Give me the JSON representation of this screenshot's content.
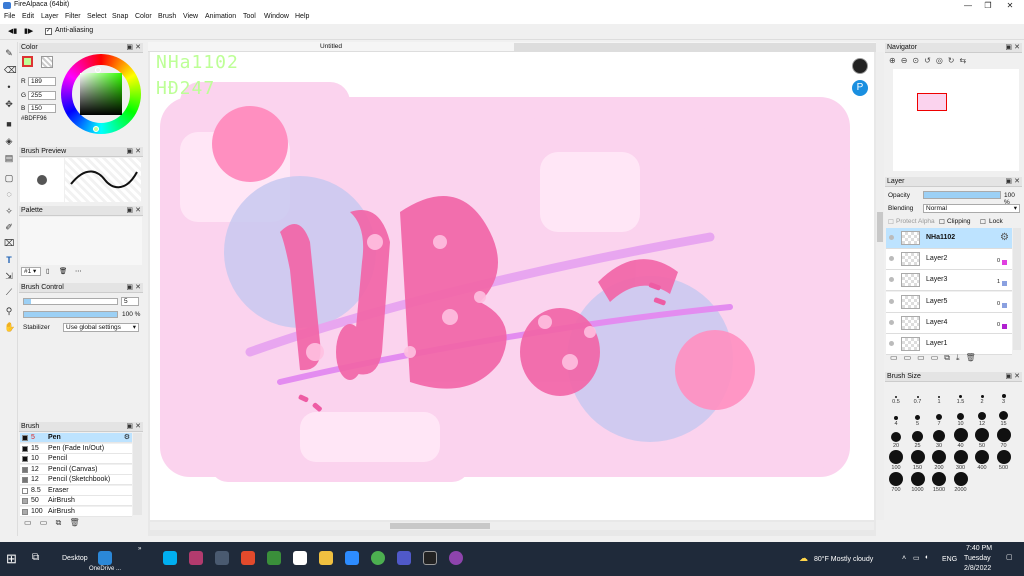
{
  "window": {
    "title": "FireAlpaca (64bit)"
  },
  "menu": [
    "File",
    "Edit",
    "Layer",
    "Filter",
    "Select",
    "Snap",
    "Color",
    "Brush",
    "View",
    "Animation",
    "Tool",
    "Window",
    "Help"
  ],
  "toolbar": {
    "antialias_label": "Anti-aliasing",
    "antialias_checked": true
  },
  "color_panel": {
    "title": "Color",
    "r_label": "R",
    "r": "189",
    "g_label": "G",
    "g": "255",
    "b_label": "B",
    "b": "150",
    "hex": "#BDFF96"
  },
  "brush_preview": {
    "title": "Brush Preview"
  },
  "palette": {
    "title": "Palette",
    "selector": "#1 ▾"
  },
  "brush_control": {
    "title": "Brush Control",
    "size": "5",
    "opacity": "100 %",
    "stabilizer_label": "Stabilizer",
    "stabilizer_value": "Use global settings"
  },
  "brush_panel": {
    "title": "Brush",
    "items": [
      {
        "size": "5",
        "name": "Pen",
        "color": "#111111",
        "selected": true
      },
      {
        "size": "15",
        "name": "Pen (Fade In/Out)",
        "color": "#111111"
      },
      {
        "size": "10",
        "name": "Pencil",
        "color": "#111111"
      },
      {
        "size": "12",
        "name": "Pencil (Canvas)",
        "color": "#777777"
      },
      {
        "size": "12",
        "name": "Pencil (Sketchbook)",
        "color": "#777777"
      },
      {
        "size": "8.5",
        "name": "Eraser",
        "color": "#ffffff"
      },
      {
        "size": "50",
        "name": "AirBrush",
        "color": "#aaaaaa"
      },
      {
        "size": "100",
        "name": "AirBrush",
        "color": "#aaaaaa"
      }
    ]
  },
  "document": {
    "tab": "Untitled",
    "watermark_line1": "NHa1102",
    "watermark_line2": "HĐ247"
  },
  "navigator": {
    "title": "Navigator"
  },
  "layer_panel": {
    "title": "Layer",
    "opacity_label": "Opacity",
    "opacity_value": "100 %",
    "opacity_fraction": 1.0,
    "blending_label": "Blending",
    "blending_value": "Normal",
    "protect_alpha": "Protect Alpha",
    "clipping": "Clipping",
    "lock": "Lock",
    "layers": [
      {
        "name": "NHa1102",
        "selected": true,
        "num": "",
        "mark": ""
      },
      {
        "name": "Layer2",
        "num": "0",
        "mark": "#e040e0"
      },
      {
        "name": "Layer3",
        "num": "1",
        "mark": "#8aa0e0"
      },
      {
        "name": "Layer5",
        "num": "0",
        "mark": "#8aa0e0"
      },
      {
        "name": "Layer4",
        "num": "0",
        "mark": "#b020d0"
      },
      {
        "name": "Layer1",
        "num": "",
        "mark": ""
      }
    ]
  },
  "brush_size": {
    "title": "Brush Size",
    "sizes": [
      "0.5",
      "0.7",
      "1",
      "1.5",
      "2",
      "3",
      "4",
      "5",
      "7",
      "10",
      "12",
      "15",
      "20",
      "25",
      "30",
      "40",
      "50",
      "70",
      "100",
      "150",
      "200",
      "300",
      "400",
      "500",
      "700",
      "1000",
      "1500",
      "2000"
    ]
  },
  "taskbar": {
    "desktop_label": "Desktop",
    "onedrive_label": "OneDrive ...",
    "weather": "80°F  Mostly cloudy",
    "language": "ENG",
    "time": "7:40 PM",
    "day": "Tuesday",
    "date": "2/8/2022"
  },
  "colors": {
    "accent": "#bde3ff",
    "brand": "#3a7bd5",
    "pink": "#ff6fa8",
    "lavender": "#c8c8f0"
  }
}
